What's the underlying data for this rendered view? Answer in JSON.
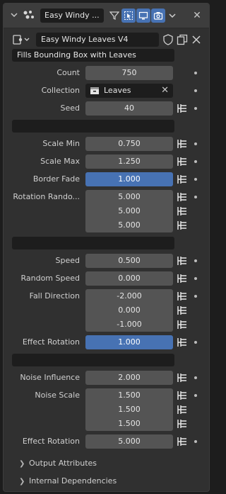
{
  "header": {
    "node_name": "Easy Windy ...",
    "close_label": "✕"
  },
  "datablock": {
    "name": "Easy Windy Leaves V4"
  },
  "description": "Fills Bounding Box with Leaves",
  "rows": {
    "count": {
      "label": "Count",
      "value": "750"
    },
    "collection": {
      "label": "Collection",
      "value": "Leaves",
      "clear": "✕"
    },
    "seed": {
      "label": "Seed",
      "value": "40"
    },
    "scale_min": {
      "label": "Scale Min",
      "value": "0.750"
    },
    "scale_max": {
      "label": "Scale Max",
      "value": "1.250"
    },
    "border_fade": {
      "label": "Border Fade",
      "value": "1.000"
    },
    "rotation_random": {
      "label": "Rotation Rando...",
      "values": [
        "5.000",
        "5.000",
        "5.000"
      ]
    },
    "speed": {
      "label": "Speed",
      "value": "0.500"
    },
    "random_speed": {
      "label": "Random Speed",
      "value": "0.000"
    },
    "fall_direction": {
      "label": "Fall Direction",
      "values": [
        "-2.000",
        "0.000",
        "-1.000"
      ]
    },
    "effect_rotation_1": {
      "label": "Effect Rotation",
      "value": "1.000"
    },
    "noise_influence": {
      "label": "Noise Influence",
      "value": "2.000"
    },
    "noise_scale": {
      "label": "Noise Scale",
      "values": [
        "1.500",
        "1.500",
        "1.500"
      ]
    },
    "effect_rotation_2": {
      "label": "Effect Rotation",
      "value": "5.000"
    }
  },
  "subpanels": {
    "output_attributes": "Output Attributes",
    "internal_dependencies": "Internal Dependencies"
  },
  "colors": {
    "accent": "#4772b3",
    "field": "#545454",
    "dark_field": "#1d1d1d",
    "panel_bg": "#303030"
  }
}
